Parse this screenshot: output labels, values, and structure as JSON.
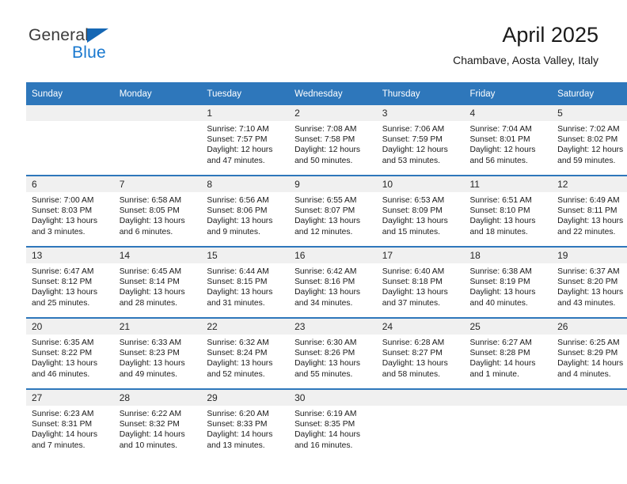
{
  "brand": {
    "name_dark": "General",
    "name_blue": "Blue",
    "accent_color": "#1878cf",
    "triangle_color": "#1567b4"
  },
  "header": {
    "month_title": "April 2025",
    "location": "Chambave, Aosta Valley, Italy"
  },
  "calendar": {
    "header_bg": "#2e77bb",
    "daynum_bg": "#f0f0f0",
    "weekday_labels": [
      "Sunday",
      "Monday",
      "Tuesday",
      "Wednesday",
      "Thursday",
      "Friday",
      "Saturday"
    ],
    "weeks": [
      [
        {
          "day": "",
          "empty": true
        },
        {
          "day": "",
          "empty": true
        },
        {
          "day": "1",
          "sunrise": "Sunrise: 7:10 AM",
          "sunset": "Sunset: 7:57 PM",
          "daylight_1": "Daylight: 12 hours",
          "daylight_2": "and 47 minutes."
        },
        {
          "day": "2",
          "sunrise": "Sunrise: 7:08 AM",
          "sunset": "Sunset: 7:58 PM",
          "daylight_1": "Daylight: 12 hours",
          "daylight_2": "and 50 minutes."
        },
        {
          "day": "3",
          "sunrise": "Sunrise: 7:06 AM",
          "sunset": "Sunset: 7:59 PM",
          "daylight_1": "Daylight: 12 hours",
          "daylight_2": "and 53 minutes."
        },
        {
          "day": "4",
          "sunrise": "Sunrise: 7:04 AM",
          "sunset": "Sunset: 8:01 PM",
          "daylight_1": "Daylight: 12 hours",
          "daylight_2": "and 56 minutes."
        },
        {
          "day": "5",
          "sunrise": "Sunrise: 7:02 AM",
          "sunset": "Sunset: 8:02 PM",
          "daylight_1": "Daylight: 12 hours",
          "daylight_2": "and 59 minutes."
        }
      ],
      [
        {
          "day": "6",
          "sunrise": "Sunrise: 7:00 AM",
          "sunset": "Sunset: 8:03 PM",
          "daylight_1": "Daylight: 13 hours",
          "daylight_2": "and 3 minutes."
        },
        {
          "day": "7",
          "sunrise": "Sunrise: 6:58 AM",
          "sunset": "Sunset: 8:05 PM",
          "daylight_1": "Daylight: 13 hours",
          "daylight_2": "and 6 minutes."
        },
        {
          "day": "8",
          "sunrise": "Sunrise: 6:56 AM",
          "sunset": "Sunset: 8:06 PM",
          "daylight_1": "Daylight: 13 hours",
          "daylight_2": "and 9 minutes."
        },
        {
          "day": "9",
          "sunrise": "Sunrise: 6:55 AM",
          "sunset": "Sunset: 8:07 PM",
          "daylight_1": "Daylight: 13 hours",
          "daylight_2": "and 12 minutes."
        },
        {
          "day": "10",
          "sunrise": "Sunrise: 6:53 AM",
          "sunset": "Sunset: 8:09 PM",
          "daylight_1": "Daylight: 13 hours",
          "daylight_2": "and 15 minutes."
        },
        {
          "day": "11",
          "sunrise": "Sunrise: 6:51 AM",
          "sunset": "Sunset: 8:10 PM",
          "daylight_1": "Daylight: 13 hours",
          "daylight_2": "and 18 minutes."
        },
        {
          "day": "12",
          "sunrise": "Sunrise: 6:49 AM",
          "sunset": "Sunset: 8:11 PM",
          "daylight_1": "Daylight: 13 hours",
          "daylight_2": "and 22 minutes."
        }
      ],
      [
        {
          "day": "13",
          "sunrise": "Sunrise: 6:47 AM",
          "sunset": "Sunset: 8:12 PM",
          "daylight_1": "Daylight: 13 hours",
          "daylight_2": "and 25 minutes."
        },
        {
          "day": "14",
          "sunrise": "Sunrise: 6:45 AM",
          "sunset": "Sunset: 8:14 PM",
          "daylight_1": "Daylight: 13 hours",
          "daylight_2": "and 28 minutes."
        },
        {
          "day": "15",
          "sunrise": "Sunrise: 6:44 AM",
          "sunset": "Sunset: 8:15 PM",
          "daylight_1": "Daylight: 13 hours",
          "daylight_2": "and 31 minutes."
        },
        {
          "day": "16",
          "sunrise": "Sunrise: 6:42 AM",
          "sunset": "Sunset: 8:16 PM",
          "daylight_1": "Daylight: 13 hours",
          "daylight_2": "and 34 minutes."
        },
        {
          "day": "17",
          "sunrise": "Sunrise: 6:40 AM",
          "sunset": "Sunset: 8:18 PM",
          "daylight_1": "Daylight: 13 hours",
          "daylight_2": "and 37 minutes."
        },
        {
          "day": "18",
          "sunrise": "Sunrise: 6:38 AM",
          "sunset": "Sunset: 8:19 PM",
          "daylight_1": "Daylight: 13 hours",
          "daylight_2": "and 40 minutes."
        },
        {
          "day": "19",
          "sunrise": "Sunrise: 6:37 AM",
          "sunset": "Sunset: 8:20 PM",
          "daylight_1": "Daylight: 13 hours",
          "daylight_2": "and 43 minutes."
        }
      ],
      [
        {
          "day": "20",
          "sunrise": "Sunrise: 6:35 AM",
          "sunset": "Sunset: 8:22 PM",
          "daylight_1": "Daylight: 13 hours",
          "daylight_2": "and 46 minutes."
        },
        {
          "day": "21",
          "sunrise": "Sunrise: 6:33 AM",
          "sunset": "Sunset: 8:23 PM",
          "daylight_1": "Daylight: 13 hours",
          "daylight_2": "and 49 minutes."
        },
        {
          "day": "22",
          "sunrise": "Sunrise: 6:32 AM",
          "sunset": "Sunset: 8:24 PM",
          "daylight_1": "Daylight: 13 hours",
          "daylight_2": "and 52 minutes."
        },
        {
          "day": "23",
          "sunrise": "Sunrise: 6:30 AM",
          "sunset": "Sunset: 8:26 PM",
          "daylight_1": "Daylight: 13 hours",
          "daylight_2": "and 55 minutes."
        },
        {
          "day": "24",
          "sunrise": "Sunrise: 6:28 AM",
          "sunset": "Sunset: 8:27 PM",
          "daylight_1": "Daylight: 13 hours",
          "daylight_2": "and 58 minutes."
        },
        {
          "day": "25",
          "sunrise": "Sunrise: 6:27 AM",
          "sunset": "Sunset: 8:28 PM",
          "daylight_1": "Daylight: 14 hours",
          "daylight_2": "and 1 minute."
        },
        {
          "day": "26",
          "sunrise": "Sunrise: 6:25 AM",
          "sunset": "Sunset: 8:29 PM",
          "daylight_1": "Daylight: 14 hours",
          "daylight_2": "and 4 minutes."
        }
      ],
      [
        {
          "day": "27",
          "sunrise": "Sunrise: 6:23 AM",
          "sunset": "Sunset: 8:31 PM",
          "daylight_1": "Daylight: 14 hours",
          "daylight_2": "and 7 minutes."
        },
        {
          "day": "28",
          "sunrise": "Sunrise: 6:22 AM",
          "sunset": "Sunset: 8:32 PM",
          "daylight_1": "Daylight: 14 hours",
          "daylight_2": "and 10 minutes."
        },
        {
          "day": "29",
          "sunrise": "Sunrise: 6:20 AM",
          "sunset": "Sunset: 8:33 PM",
          "daylight_1": "Daylight: 14 hours",
          "daylight_2": "and 13 minutes."
        },
        {
          "day": "30",
          "sunrise": "Sunrise: 6:19 AM",
          "sunset": "Sunset: 8:35 PM",
          "daylight_1": "Daylight: 14 hours",
          "daylight_2": "and 16 minutes."
        },
        {
          "day": "",
          "empty": true
        },
        {
          "day": "",
          "empty": true
        },
        {
          "day": "",
          "empty": true
        }
      ]
    ]
  }
}
